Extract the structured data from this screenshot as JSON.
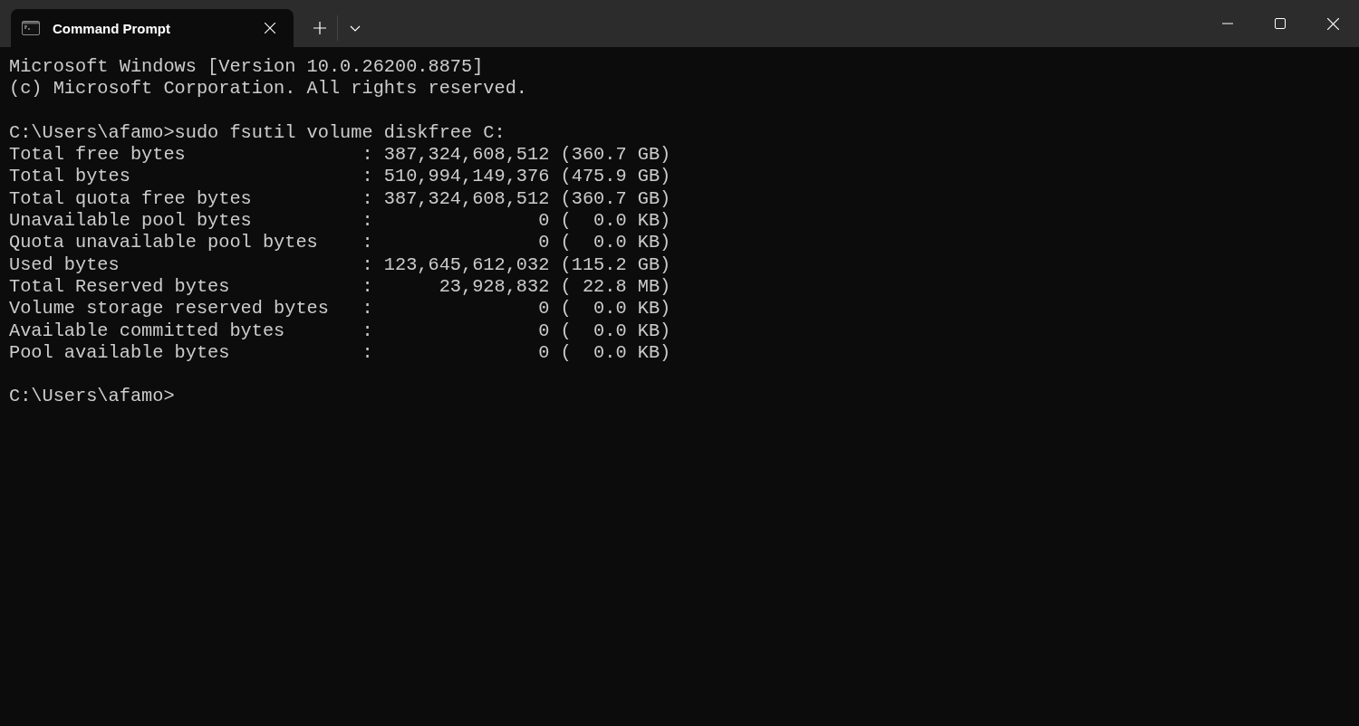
{
  "tabs": [
    {
      "title": "Command Prompt",
      "selected": true
    }
  ],
  "terminal": {
    "blocks": [
      [
        "Microsoft Windows [Version 10.0.26200.8875]",
        "(c) Microsoft Corporation. All rights reserved."
      ],
      [
        "C:\\Users\\afamo>sudo fsutil volume diskfree C:",
        "Total free bytes                : 387,324,608,512 (360.7 GB)",
        "Total bytes                     : 510,994,149,376 (475.9 GB)",
        "Total quota free bytes          : 387,324,608,512 (360.7 GB)",
        "Unavailable pool bytes          :               0 (  0.0 KB)",
        "Quota unavailable pool bytes    :               0 (  0.0 KB)",
        "Used bytes                      : 123,645,612,032 (115.2 GB)",
        "Total Reserved bytes            :      23,928,832 ( 22.8 MB)",
        "Volume storage reserved bytes   :               0 (  0.0 KB)",
        "Available committed bytes       :               0 (  0.0 KB)",
        "Pool available bytes            :               0 (  0.0 KB)"
      ],
      [
        "C:\\Users\\afamo>"
      ]
    ]
  }
}
